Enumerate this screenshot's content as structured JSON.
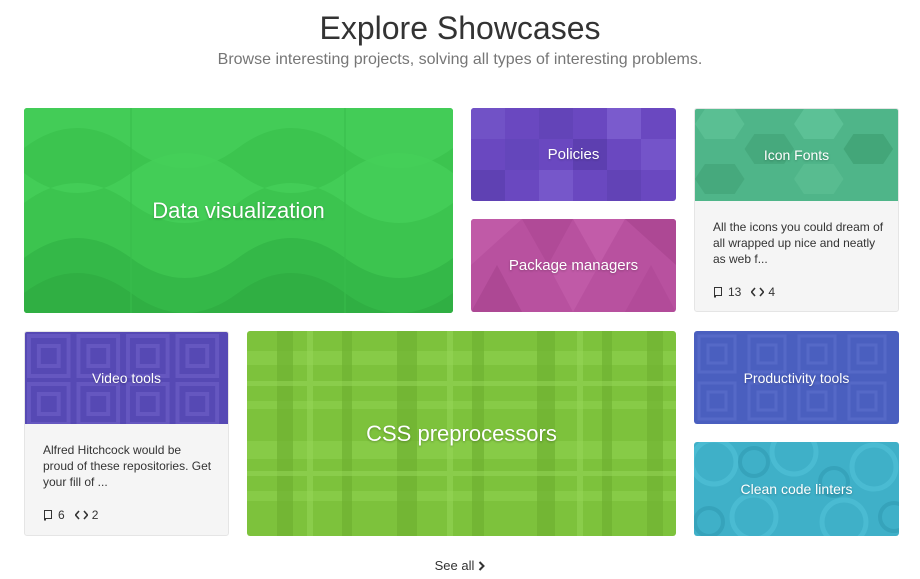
{
  "header": {
    "title": "Explore Showcases",
    "subtitle": "Browse interesting projects, solving all types of interesting problems."
  },
  "showcases": {
    "data_visualization": {
      "title": "Data visualization",
      "color": "#3cc44f"
    },
    "policies": {
      "title": "Policies",
      "color": "#6a48c0"
    },
    "package_managers": {
      "title": "Package managers",
      "color": "#b8519f"
    },
    "icon_fonts": {
      "title": "Icon Fonts",
      "color": "#4fb589",
      "description": "All the icons you could dream of all wrapped up nice and neatly as web f...",
      "repo_count": "13",
      "language_count": "4",
      "repo_icon": "repo-icon",
      "code_icon": "code-icon"
    },
    "video_tools": {
      "title": "Video tools",
      "color": "#5649b4",
      "description": "Alfred Hitchcock would be proud of these repositories. Get your fill of ...",
      "repo_count": "6",
      "language_count": "2",
      "repo_icon": "repo-icon",
      "code_icon": "code-icon"
    },
    "css_preprocessors": {
      "title": "CSS preprocessors",
      "color": "#7dc23c"
    },
    "productivity_tools": {
      "title": "Productivity tools",
      "color": "#4a5fbf"
    },
    "clean_code_linters": {
      "title": "Clean code linters",
      "color": "#3fb0c8"
    }
  },
  "footer": {
    "see_all_label": "See all",
    "see_all_icon": "chevron-right-icon"
  }
}
